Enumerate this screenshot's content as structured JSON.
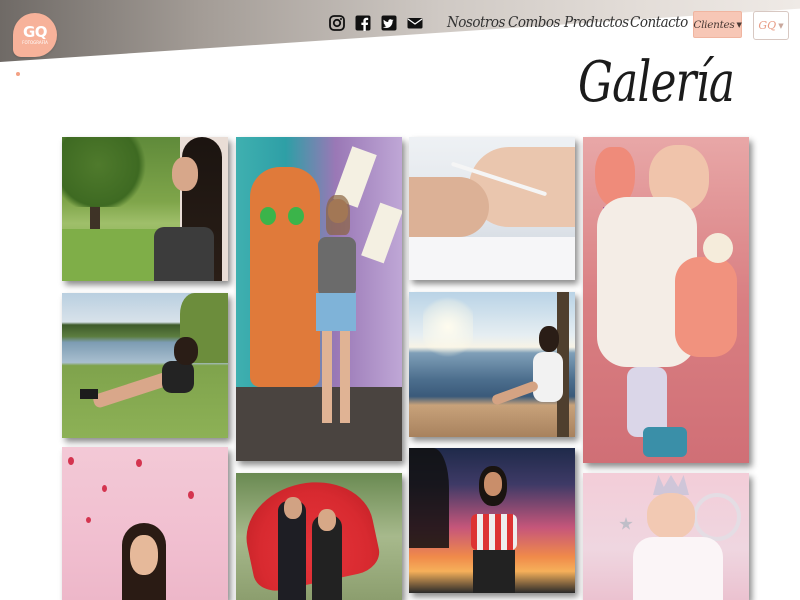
{
  "brand": {
    "logo_text": "GQ",
    "logo_subtext": "FOTOGRAFÍA"
  },
  "social": [
    "instagram-icon",
    "facebook-icon",
    "twitter-icon",
    "envelope-icon"
  ],
  "nav": {
    "items": [
      "Nosotros",
      "Combos",
      "Productos",
      "Contacto"
    ]
  },
  "clientes_button": {
    "label": "Clientes"
  },
  "gq_button": {
    "label": "GQ"
  },
  "page": {
    "title": "Galería"
  },
  "gallery": {
    "photos": [
      "girl-in-park",
      "girl-by-mural",
      "hands-with-rosary",
      "sleeping-newborn",
      "girl-on-grass-by-lake",
      "girl-on-beach",
      "red-wall-portrait",
      "couple-with-red-umbrella",
      "girl-at-sunset",
      "baby-with-tiara"
    ]
  },
  "colors": {
    "accent": "#f7c7b6",
    "logo": "#f7b29a",
    "text": "#1b1b1b"
  }
}
